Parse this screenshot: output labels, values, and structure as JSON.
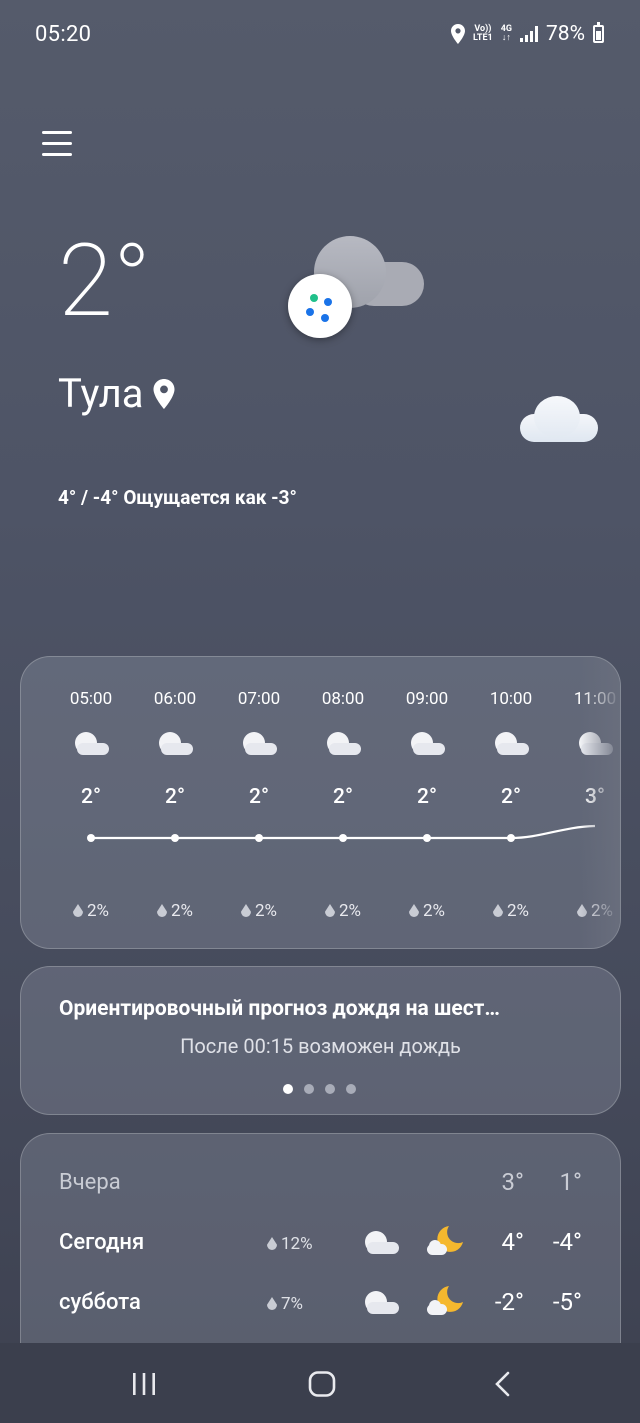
{
  "status_bar": {
    "time": "05:20",
    "net_volte": "Vo))",
    "net_lte": "LTE1",
    "net_4g": "4G",
    "battery": "78%"
  },
  "current": {
    "temperature": "2°",
    "city": "Тула",
    "details": "4° / -4° Ощущается как -3°"
  },
  "hourly": [
    {
      "time": "05:00",
      "temp": "2°",
      "precip": "2%"
    },
    {
      "time": "06:00",
      "temp": "2°",
      "precip": "2%"
    },
    {
      "time": "07:00",
      "temp": "2°",
      "precip": "2%"
    },
    {
      "time": "08:00",
      "temp": "2°",
      "precip": "2%"
    },
    {
      "time": "09:00",
      "temp": "2°",
      "precip": "2%"
    },
    {
      "time": "10:00",
      "temp": "2°",
      "precip": "2%"
    },
    {
      "time": "11:00",
      "temp": "3°",
      "precip": "2%"
    }
  ],
  "rain_card": {
    "title": "Ориентировочный прогноз дождя на шест…",
    "subtitle": "После 00:15 возможен дождь",
    "pages": 4,
    "active_page": 1
  },
  "daily": [
    {
      "name": "Вчера",
      "precip": "",
      "max": "3°",
      "min": "1°"
    },
    {
      "name": "Сегодня",
      "precip": "12%",
      "max": "4°",
      "min": "-4°"
    },
    {
      "name": "суббота",
      "precip": "7%",
      "max": "-2°",
      "min": "-5°"
    }
  ],
  "colors": {
    "background": "#4e5466",
    "card": "#7a7f8e",
    "moon": "#f5b82e",
    "cloud": "#f2f3f6",
    "assistant_green": "#20c08a",
    "assistant_blue": "#1a73e8"
  },
  "icons": {
    "menu": "menu-icon",
    "location": "location-pin-icon",
    "assistant": "assistant-dots-icon",
    "weather_cloudy": "cloud-icon",
    "weather_night": "moon-cloud-icon",
    "precip": "raindrop-icon"
  }
}
